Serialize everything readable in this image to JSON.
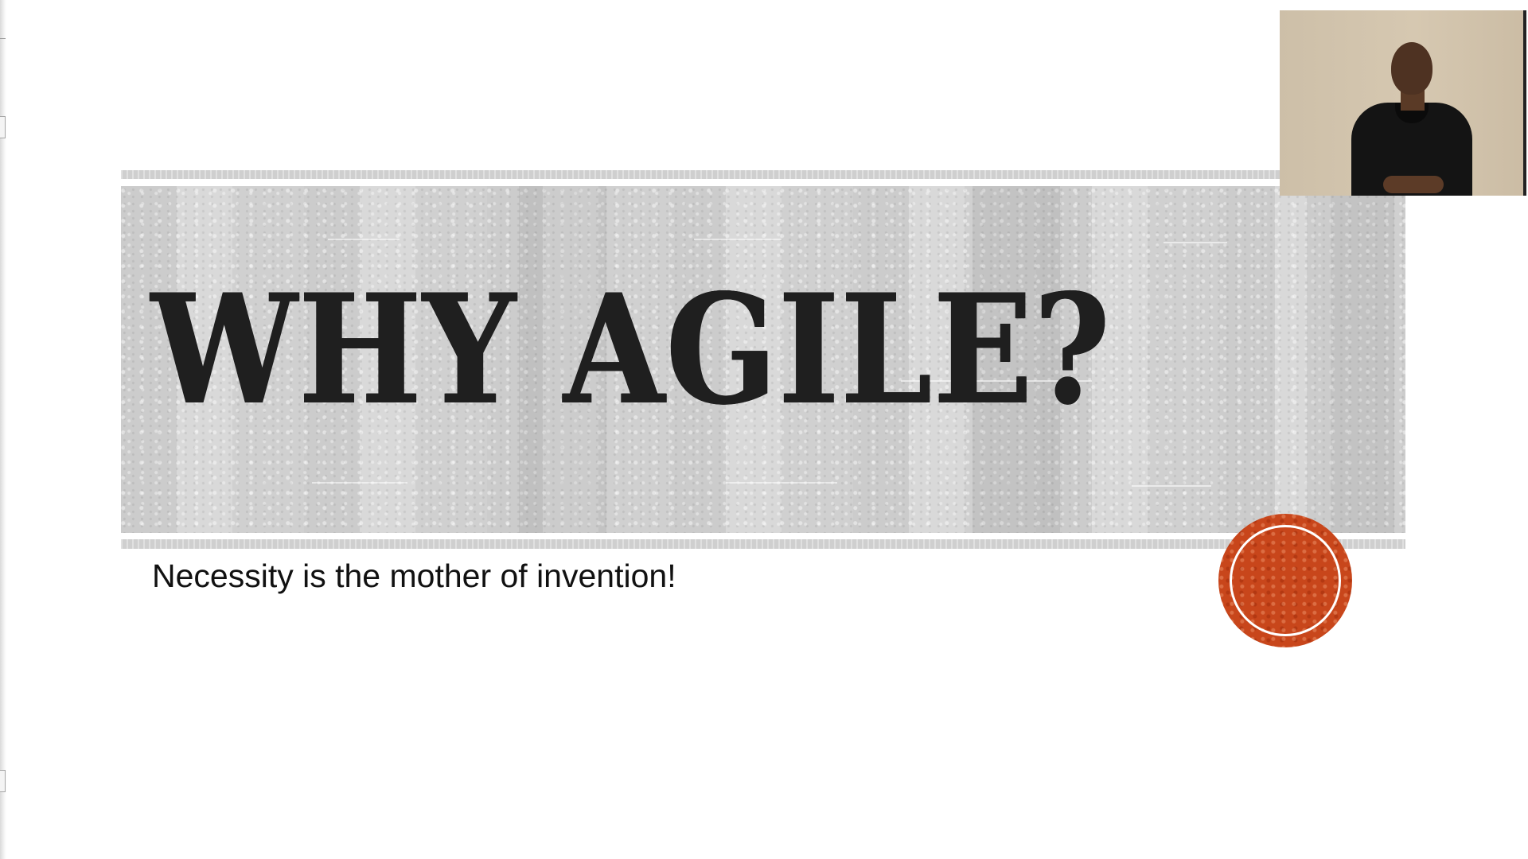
{
  "slide": {
    "title": "WHY AGILE?",
    "subtitle": "Necessity is the mother of invention!"
  },
  "colors": {
    "background": "#ffffff",
    "band": "#d7d7d7",
    "title_text": "#1f1f1f",
    "accent_circle": "#c8461b"
  },
  "webcam": {
    "icon": "presenter-video-feed"
  }
}
